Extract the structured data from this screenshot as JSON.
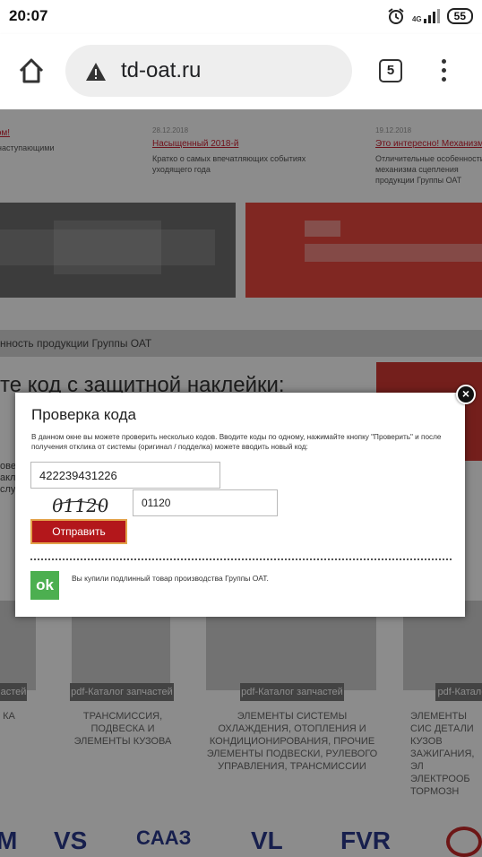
{
  "status_bar": {
    "time": "20:07",
    "network_top": "4G",
    "battery": "55",
    "icons": [
      "alarm-icon",
      "signal-icon",
      "battery-icon"
    ]
  },
  "browser": {
    "url": "td-oat.ru",
    "tab_count": "5",
    "icons": [
      "home-icon",
      "warning-icon",
      "menu-dots-icon"
    ]
  },
  "background_page": {
    "news": [
      {
        "date": "",
        "title": "дом!",
        "text": "с наступающими"
      },
      {
        "date": "28.12.2018",
        "title": "Насыщенный 2018-й",
        "text": "Кратко о самых впечатляющих событиях уходящего года"
      },
      {
        "date": "19.12.2018",
        "title": "Это интересно! Механизм",
        "text": "Отличительные особенности механизма сцепления продукции Группы ОАТ"
      }
    ],
    "strip_text": "нность продукции Группы ОАТ",
    "heading": "те код с защитной наклейки:",
    "side_text": [
      "ове",
      "акл",
      "слу"
    ],
    "catalog": [
      {
        "button": "астей",
        "text": "КА"
      },
      {
        "button": "pdf-Каталог запчастей",
        "text": "ТРАНСМИССИЯ, ПОДВЕСКА И ЭЛЕМЕНТЫ КУЗОВА"
      },
      {
        "button": "pdf-Каталог запчастей",
        "text": "ЭЛЕМЕНТЫ СИСТЕМЫ ОХЛАЖДЕНИЯ, ОТОПЛЕНИЯ И КОНДИЦИОНИРОВАНИЯ, ПРОЧИЕ ЭЛЕМЕНТЫ ПОДВЕСКИ, РУЛЕВОГО УПРАВЛЕНИЯ, ТРАНСМИССИИ"
      },
      {
        "button": "pdf-Катало",
        "text": "ЭЛЕМЕНТЫ СИС ДЕТАЛИ КУЗОВ ЗАЖИГАНИЯ, ЭЛ ЭЛЕКТРООБ ТОРМОЗН"
      }
    ],
    "logos": [
      "M",
      "VS",
      "CAAЗ",
      "VL",
      "FVR",
      ""
    ]
  },
  "modal": {
    "title": "Проверка кода",
    "description": "В данном окне вы можете проверить несколько кодов. Вводите коды по одному, нажимайте кнопку \"Проверить\" и после получения отклика от системы (оригинал / подделка) можете вводить новый код:",
    "code_value": "422239431226",
    "captcha_image_text": "01120",
    "captcha_value": "01120",
    "submit_label": "Отправить",
    "result_badge": "ok",
    "result_text": "Вы купили подлинный товар производства Группы ОАТ.",
    "close_symbol": "×",
    "colors": {
      "submit_bg": "#b3171b",
      "submit_border": "#e3a34a",
      "ok_bg": "#4caf50"
    }
  }
}
